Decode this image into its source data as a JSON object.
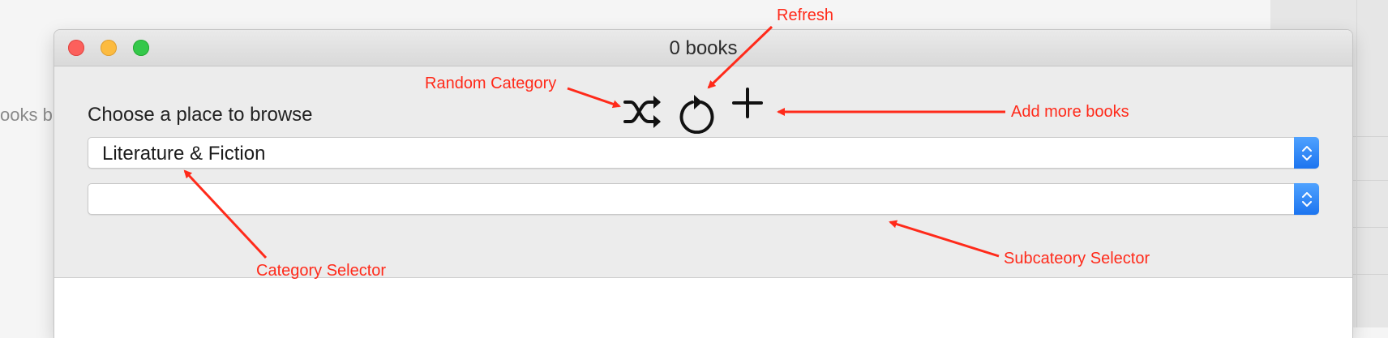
{
  "background": {
    "partial_text": "ooks b"
  },
  "window": {
    "title": "0 books"
  },
  "main": {
    "prompt": "Choose a place to browse",
    "category_select": {
      "value": "Literature & Fiction"
    },
    "subcategory_select": {
      "value": ""
    }
  },
  "toolbar": {
    "icons": [
      "shuffle-icon",
      "refresh-icon",
      "plus-icon"
    ]
  },
  "annotations": {
    "refresh": "Refresh",
    "random_category": "Random Category",
    "add_more_books": "Add more books",
    "category_selector": "Category Selector",
    "subcategory_selector": "Subcateory Selector"
  },
  "colors": {
    "annotation_red": "#ff2a1a",
    "stepper_blue": "#1c74ef",
    "close": "#fc605c",
    "minimize": "#fcbb40",
    "maximize": "#34c84a"
  }
}
